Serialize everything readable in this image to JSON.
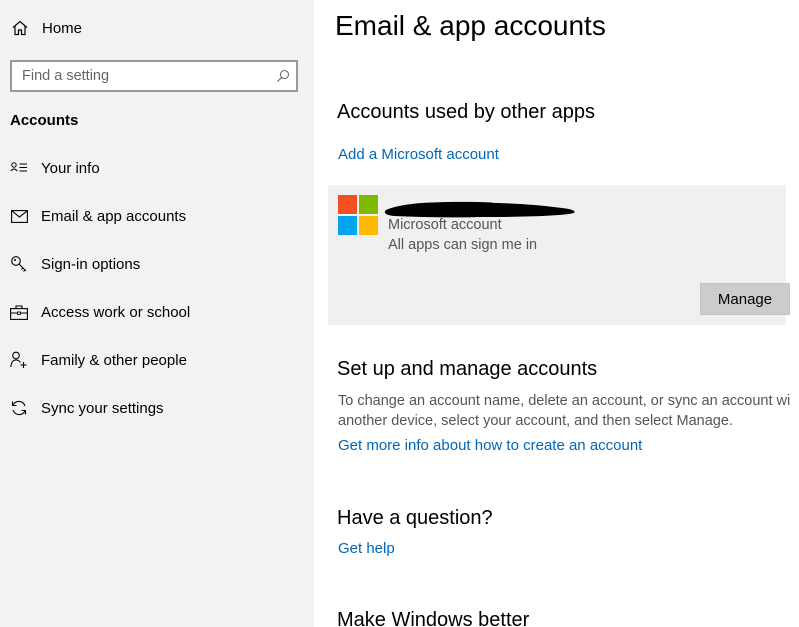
{
  "nav": {
    "home_label": "Home",
    "home_icon": "home-icon",
    "search_placeholder": "Find a setting",
    "search_icon": "search-icon",
    "section_title": "Accounts",
    "items": [
      {
        "label": "Your info",
        "icon": "person-card-icon"
      },
      {
        "label": "Email & app accounts",
        "icon": "mail-icon"
      },
      {
        "label": "Sign-in options",
        "icon": "key-icon"
      },
      {
        "label": "Access work or school",
        "icon": "briefcase-icon"
      },
      {
        "label": "Family & other people",
        "icon": "person-add-icon"
      },
      {
        "label": "Sync your settings",
        "icon": "sync-icon"
      }
    ]
  },
  "main": {
    "title": "Email & app accounts",
    "accounts_section": {
      "heading": "Accounts used by other apps",
      "add_link": "Add a Microsoft account",
      "account": {
        "type": "Microsoft account",
        "subtitle": "All apps can sign me in",
        "manage_label": "Manage"
      }
    },
    "setup_section": {
      "heading": "Set up and manage accounts",
      "description_line1": "To change an account name, delete an account, or sync an account wi",
      "description_line2": "another device, select your account, and then select Manage.",
      "info_link": "Get more info about how to create an account"
    },
    "question_section": {
      "heading": "Have a question?",
      "help_link": "Get help"
    },
    "better_section": {
      "heading": "Make Windows better"
    }
  },
  "colors": {
    "link": "#0067b8",
    "nav_background": "#f2f2f2",
    "card_background": "#f0f0f0",
    "button_background": "#cccccc",
    "logo_red": "#f25022",
    "logo_green": "#7fba00",
    "logo_blue": "#00a4ef",
    "logo_yellow": "#ffb900"
  }
}
